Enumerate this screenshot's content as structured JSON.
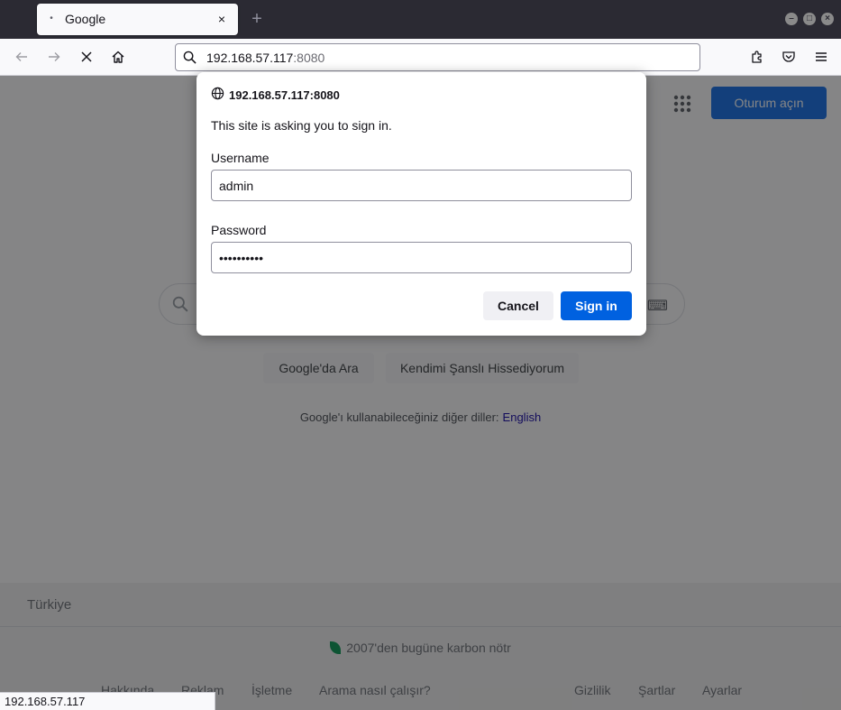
{
  "browser": {
    "tab": {
      "title": "Google",
      "close_glyph": "×",
      "favicon": "•"
    },
    "new_tab_glyph": "+",
    "window_controls": {
      "minimize": "–",
      "maximize": "□",
      "close": "×"
    },
    "url": {
      "host": "192.168.57.117",
      "port": ":8080"
    },
    "status_text": "192.168.57.117"
  },
  "google_page": {
    "signin_label": "Oturum açın",
    "search_button": "Google'da Ara",
    "lucky_button": "Kendimi Şanslı Hissediyorum",
    "languages_text": "Google'ı kullanabileceğiniz diğer diller:",
    "languages_link": "English",
    "footer": {
      "country": "Türkiye",
      "carbon_text": "2007'den bugüne karbon nötr",
      "left_links": [
        "Hakkında",
        "Reklam",
        "İşletme",
        "Arama nasıl çalışır?"
      ],
      "right_links": [
        "Gizlilik",
        "Şartlar",
        "Ayarlar"
      ]
    },
    "keyboard_glyph": "⌨"
  },
  "auth_dialog": {
    "origin": "192.168.57.117:8080",
    "message": "This site is asking you to sign in.",
    "username_label": "Username",
    "username_value": "admin",
    "password_label": "Password",
    "password_value": "••••••••••",
    "cancel_label": "Cancel",
    "signin_label": "Sign in"
  },
  "colors": {
    "accent": "#0061e0",
    "google_blue": "#1a73e8",
    "titlebar": "#2b2a33"
  }
}
